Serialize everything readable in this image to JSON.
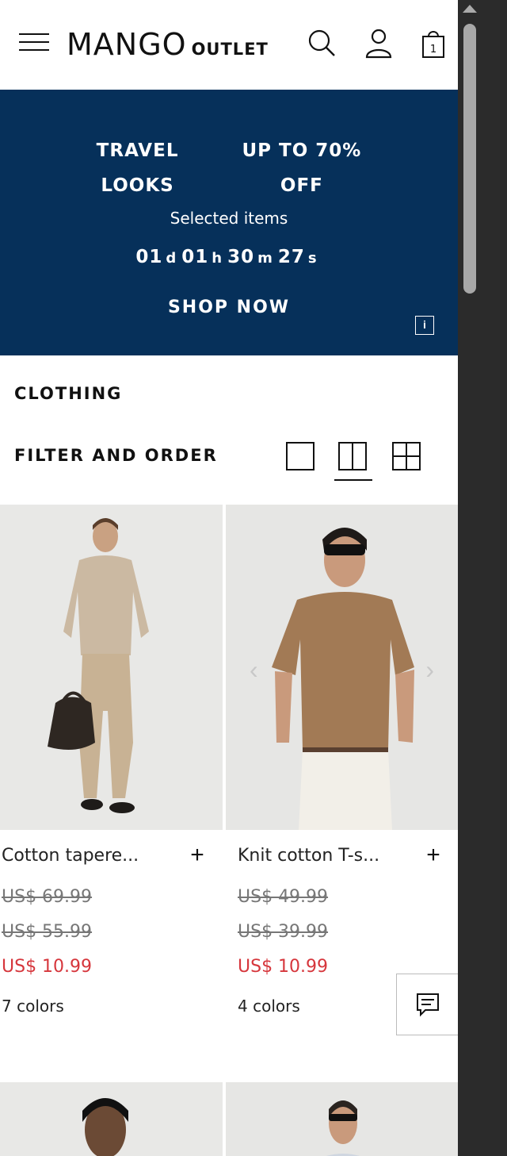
{
  "header": {
    "brand": "MANGO",
    "brand_sub": "OUTLET",
    "cart_count": "1"
  },
  "promo": {
    "title_left_1": "TRAVEL",
    "title_left_2": "LOOKS",
    "title_right_1": "UP TO 70%",
    "title_right_2": "OFF",
    "subtitle": "Selected items",
    "timer": {
      "days": "01",
      "hours": "01",
      "minutes": "30",
      "seconds": "27",
      "d": "d",
      "h": "h",
      "m": "m",
      "s": "s"
    },
    "cta": "SHOP NOW",
    "info": "i"
  },
  "section": {
    "title": "CLOTHING",
    "filter_label": "FILTER AND ORDER",
    "active_view": "two-column"
  },
  "products": [
    {
      "name": "Cotton tapere...",
      "old_price_1": "US$ 69.99",
      "old_price_2": "US$ 55.99",
      "sale_price": "US$ 10.99",
      "colors": "7 colors",
      "add": "+"
    },
    {
      "name": "Knit cotton T-s...",
      "old_price_1": "US$ 49.99",
      "old_price_2": "US$ 39.99",
      "sale_price": "US$ 10.99",
      "colors": "4 colors",
      "add": "+"
    }
  ],
  "colors": {
    "banner": "#06305a",
    "sale": "#d6363c",
    "old_price": "#777777"
  },
  "arrows": {
    "prev": "‹",
    "next": "›"
  }
}
